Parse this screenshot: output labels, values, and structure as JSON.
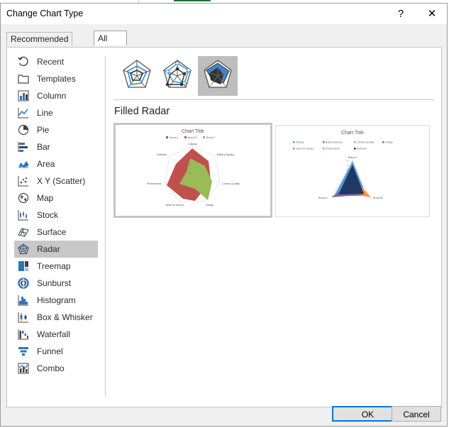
{
  "dialog": {
    "title": "Change Chart Type",
    "help_label": "?",
    "close_label": "✕"
  },
  "tabs": [
    {
      "label": "Recommended Charts",
      "active": false
    },
    {
      "label": "All Charts",
      "active": true
    }
  ],
  "sidebar": {
    "items": [
      {
        "label": "Recent",
        "icon": "recent-icon"
      },
      {
        "label": "Templates",
        "icon": "templates-icon"
      },
      {
        "label": "Column",
        "icon": "column-chart-icon"
      },
      {
        "label": "Line",
        "icon": "line-chart-icon"
      },
      {
        "label": "Pie",
        "icon": "pie-chart-icon"
      },
      {
        "label": "Bar",
        "icon": "bar-chart-icon"
      },
      {
        "label": "Area",
        "icon": "area-chart-icon"
      },
      {
        "label": "X Y (Scatter)",
        "icon": "scatter-chart-icon"
      },
      {
        "label": "Map",
        "icon": "map-chart-icon"
      },
      {
        "label": "Stock",
        "icon": "stock-chart-icon"
      },
      {
        "label": "Surface",
        "icon": "surface-chart-icon"
      },
      {
        "label": "Radar",
        "icon": "radar-chart-icon",
        "selected": true
      },
      {
        "label": "Treemap",
        "icon": "treemap-chart-icon"
      },
      {
        "label": "Sunburst",
        "icon": "sunburst-chart-icon"
      },
      {
        "label": "Histogram",
        "icon": "histogram-chart-icon"
      },
      {
        "label": "Box & Whisker",
        "icon": "box-whisker-chart-icon"
      },
      {
        "label": "Waterfall",
        "icon": "waterfall-chart-icon"
      },
      {
        "label": "Funnel",
        "icon": "funnel-chart-icon"
      },
      {
        "label": "Combo",
        "icon": "combo-chart-icon"
      }
    ]
  },
  "subtypes": [
    {
      "icon": "radar-subtype-icon",
      "selected": false
    },
    {
      "icon": "radar-with-markers-subtype-icon",
      "selected": false
    },
    {
      "icon": "filled-radar-subtype-icon",
      "selected": true
    }
  ],
  "section_title": "Filled Radar",
  "previews": [
    {
      "title": "Chart Title",
      "legend": [
        "Brand A",
        "Brand B",
        "Brand C"
      ],
      "legend_colors": [
        "#4472c4",
        "#c0504d",
        "#9bbb59"
      ],
      "axes": [
        "Display",
        "Battery Backup",
        "Camera Quality",
        "Design",
        "Value for Money",
        "Performance",
        "Software"
      ],
      "scale_labels": [
        "6",
        "4",
        "2",
        "0"
      ],
      "series_colors": [
        "#4472c4",
        "#c0504d",
        "#9bbb59"
      ]
    },
    {
      "title": "Chart Title",
      "legend": [
        "Display",
        "Battery Backup",
        "Camera Quality",
        "Design",
        "Value for Money",
        "Performance",
        "Software"
      ],
      "legend_colors": [
        "#5b9bd5",
        "#c0504d",
        "#9bbb59",
        "#8064a2",
        "#4bacc6",
        "#f79646",
        "#1f3864"
      ],
      "axes": [
        "Brand A",
        "Brand B",
        "Brand C"
      ],
      "scale_labels": [
        "6",
        "4",
        "2",
        "0"
      ],
      "series_colors": [
        "#5b9bd5",
        "#f79646",
        "#8064a2",
        "#1f3864"
      ]
    }
  ],
  "buttons": {
    "ok": "OK",
    "cancel": "Cancel"
  }
}
